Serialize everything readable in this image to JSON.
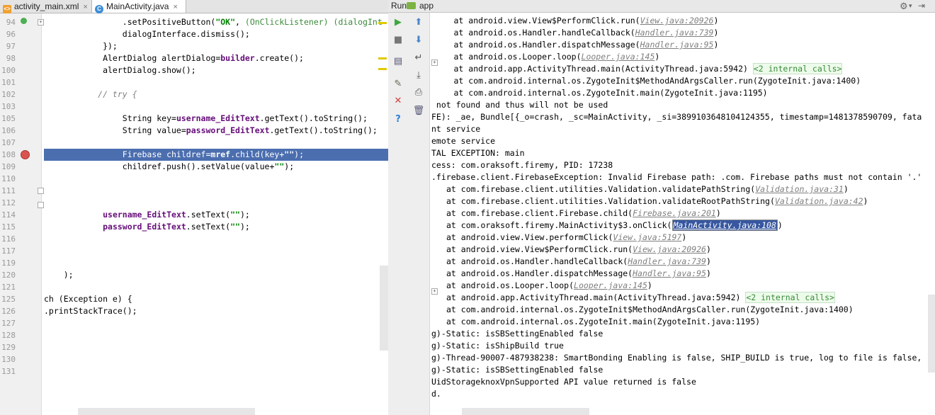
{
  "tabs": [
    {
      "label": "activity_main.xml",
      "icon": "xml-file-icon"
    },
    {
      "label": "MainActivity.java",
      "icon": "java-class-icon"
    }
  ],
  "editor": {
    "lines": [
      {
        "n": "94",
        "code": "                .setPositiveButton(\"OK\", (OnClickListener) (dialogInt"
      },
      {
        "n": "96",
        "code": "                dialogInterface.dismiss();"
      },
      {
        "n": "97",
        "code": "            });"
      },
      {
        "n": "98",
        "code": "            AlertDialog alertDialog=builder.create();"
      },
      {
        "n": "100",
        "code": "            alertDialog.show();"
      },
      {
        "n": "101",
        "code": ""
      },
      {
        "n": "102",
        "code": "           // try {"
      },
      {
        "n": "103",
        "code": ""
      },
      {
        "n": "105",
        "code": "                String key=username_EditText.getText().toString();"
      },
      {
        "n": "106",
        "code": "                String value=password_EditText.getText().toString();"
      },
      {
        "n": "107",
        "code": ""
      },
      {
        "n": "108",
        "code": "                Firebase childref=mref.child(key+\"\");"
      },
      {
        "n": "109",
        "code": "                childref.push().setValue(value+\"\");"
      },
      {
        "n": "110",
        "code": ""
      },
      {
        "n": "111",
        "code": ""
      },
      {
        "n": "112",
        "code": ""
      },
      {
        "n": "114",
        "code": "            username_EditText.setText(\"\");"
      },
      {
        "n": "115",
        "code": "            password_EditText.setText(\"\");"
      },
      {
        "n": "116",
        "code": ""
      },
      {
        "n": "117",
        "code": ""
      },
      {
        "n": "119",
        "code": ""
      },
      {
        "n": "120",
        "code": "    );"
      },
      {
        "n": "121",
        "code": ""
      },
      {
        "n": "125",
        "code": "ch (Exception e) {"
      },
      {
        "n": "126",
        "code": ".printStackTrace();"
      },
      {
        "n": "127",
        "code": ""
      },
      {
        "n": "128",
        "code": ""
      },
      {
        "n": "129",
        "code": ""
      },
      {
        "n": "130",
        "code": ""
      },
      {
        "n": "131",
        "code": ""
      }
    ]
  },
  "run": {
    "label": "Run",
    "config": "app",
    "lines": [
      {
        "indent": 3,
        "text": "at android.view.View$PerformClick.run(",
        "link": "View.java:20926",
        "tail": ")"
      },
      {
        "indent": 3,
        "text": "at android.os.Handler.handleCallback(",
        "link": "Handler.java:739",
        "tail": ")"
      },
      {
        "indent": 3,
        "text": "at android.os.Handler.dispatchMessage(",
        "link": "Handler.java:95",
        "tail": ")"
      },
      {
        "indent": 3,
        "text": "at android.os.Looper.loop(",
        "link": "Looper.java:145",
        "tail": ")"
      },
      {
        "indent": 3,
        "text": "at android.app.ActivityThread.main(ActivityThread.java:5942) ",
        "hint": "<2 internal calls>"
      },
      {
        "indent": 3,
        "text": "at com.android.internal.os.ZygoteInit$MethodAndArgsCaller.run(ZygoteInit.java:1400)"
      },
      {
        "indent": 3,
        "text": "at com.android.internal.os.ZygoteInit.main(ZygoteInit.java:1195)"
      },
      {
        "indent": 0,
        "text": " not found and thus will not be used"
      },
      {
        "indent": 0,
        "text": "FE): _ae, Bundle[{_o=crash, _sc=MainActivity, _si=3899103648104124355, timestamp=1481378590709, fata"
      },
      {
        "indent": 0,
        "text": "nt service"
      },
      {
        "indent": 0,
        "text": "emote service"
      },
      {
        "indent": 0,
        "text": "TAL EXCEPTION: main"
      },
      {
        "indent": 0,
        "text": "cess: com.oraksoft.firemy, PID: 17238"
      },
      {
        "indent": 0,
        "text": ".firebase.client.FirebaseException: Invalid Firebase path: .com. Firebase paths must not contain '.'"
      },
      {
        "indent": 2,
        "text": "at com.firebase.client.utilities.Validation.validatePathString(",
        "link": "Validation.java:31",
        "tail": ")"
      },
      {
        "indent": 2,
        "text": "at com.firebase.client.utilities.Validation.validateRootPathString(",
        "link": "Validation.java:42",
        "tail": ")"
      },
      {
        "indent": 2,
        "text": "at com.firebase.client.Firebase.child(",
        "link": "Firebase.java:201",
        "tail": ")"
      },
      {
        "indent": 2,
        "text": "at com.oraksoft.firemy.MainActivity$3.onClick(",
        "link": "MainActivity.java:108",
        "tail": ")",
        "selected": true
      },
      {
        "indent": 2,
        "text": "at android.view.View.performClick(",
        "link": "View.java:5197",
        "tail": ")"
      },
      {
        "indent": 2,
        "text": "at android.view.View$PerformClick.run(",
        "link": "View.java:20926",
        "tail": ")"
      },
      {
        "indent": 2,
        "text": "at android.os.Handler.handleCallback(",
        "link": "Handler.java:739",
        "tail": ")"
      },
      {
        "indent": 2,
        "text": "at android.os.Handler.dispatchMessage(",
        "link": "Handler.java:95",
        "tail": ")"
      },
      {
        "indent": 2,
        "text": "at android.os.Looper.loop(",
        "link": "Looper.java:145",
        "tail": ")"
      },
      {
        "indent": 2,
        "text": "at android.app.ActivityThread.main(ActivityThread.java:5942) ",
        "hint": "<2 internal calls>"
      },
      {
        "indent": 2,
        "text": "at com.android.internal.os.ZygoteInit$MethodAndArgsCaller.run(ZygoteInit.java:1400)"
      },
      {
        "indent": 2,
        "text": "at com.android.internal.os.ZygoteInit.main(ZygoteInit.java:1195)"
      },
      {
        "indent": 0,
        "text": "g)-Static: isSBSettingEnabled false"
      },
      {
        "indent": 0,
        "text": "g)-Static: isShipBuild true"
      },
      {
        "indent": 0,
        "text": "g)-Thread-90007-487938238: SmartBonding Enabling is false, SHIP_BUILD is true, log to file is false,"
      },
      {
        "indent": 0,
        "text": "g)-Static: isSBSettingEnabled false"
      },
      {
        "indent": 0,
        "text": "UidStorageknoxVpnSupported API value returned is false"
      },
      {
        "indent": 0,
        "text": "d."
      }
    ]
  },
  "colors": {
    "highlight": "#4b6eaf",
    "breakpoint": "#d9534f",
    "run_green": "#3fa83f",
    "stop_red": "#d63b3b"
  }
}
